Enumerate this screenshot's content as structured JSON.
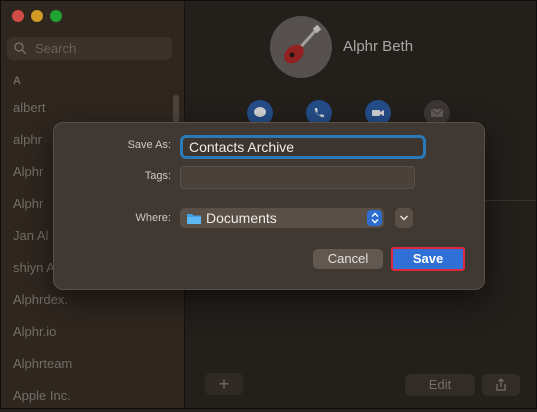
{
  "window": {
    "traffic_lights": [
      "close",
      "minimize",
      "zoom"
    ]
  },
  "sidebar": {
    "search_placeholder": "Search",
    "section_letter": "A",
    "contacts": [
      "albert",
      "alphr",
      "Alphr",
      "Alphr",
      "Jan Al",
      "shiyn A",
      "Alphrdex.",
      "Alphr.io",
      "Alphrteam",
      "Apple Inc."
    ],
    "add_label": "+"
  },
  "contact": {
    "name": "Alphr Beth",
    "actions": [
      "message-icon",
      "phone-icon",
      "video-icon",
      "mail-icon"
    ]
  },
  "toolbar": {
    "edit_label": "Edit",
    "share_icon": "share-icon"
  },
  "dialog": {
    "save_as_label": "Save As:",
    "save_as_value": "Contacts Archive",
    "tags_label": "Tags:",
    "tags_value": "",
    "where_label": "Where:",
    "where_value": "Documents",
    "cancel_label": "Cancel",
    "save_label": "Save"
  },
  "colors": {
    "accent": "#2f6fd6",
    "highlight_outline": "#e0283a",
    "focus_ring": "#2b7ab8"
  }
}
